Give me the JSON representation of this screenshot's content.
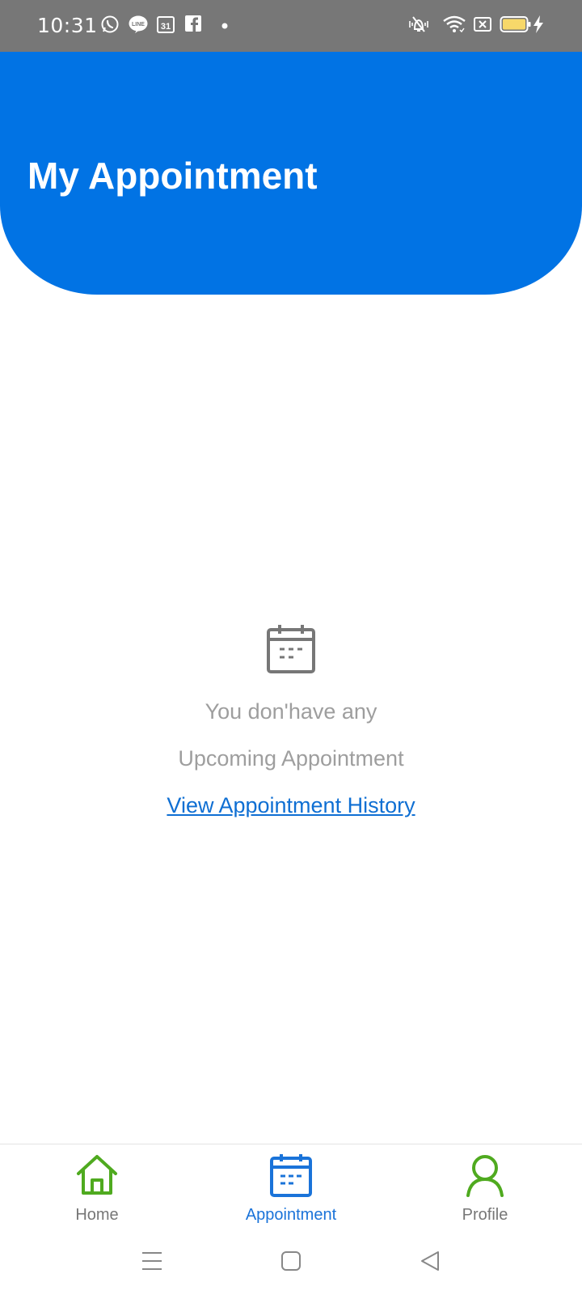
{
  "status_bar": {
    "time": "10:31",
    "left_icons": [
      "whatsapp-icon",
      "line-icon",
      "calendar-31-icon",
      "facebook-icon",
      "dot-icon"
    ],
    "right_icons": [
      "vibrate-off-icon",
      "wifi-icon",
      "no-sim-icon",
      "battery-icon",
      "charging-icon"
    ],
    "calendar_day": "31"
  },
  "header": {
    "title": "My Appointment",
    "color": "#0173e4"
  },
  "empty_state": {
    "icon": "calendar-icon",
    "line1": "You don'have any",
    "line2": "Upcoming Appointment",
    "link_label": "View Appointment History"
  },
  "bottom_nav": {
    "items": [
      {
        "label": "Home",
        "icon": "home-icon",
        "color": "#4faa1f",
        "label_color": "#777777"
      },
      {
        "label": "Appointment",
        "icon": "calendar-icon",
        "color": "#1a73d9",
        "label_color": "#1a73d9",
        "active": true
      },
      {
        "label": "Profile",
        "icon": "person-icon",
        "color": "#4faa1f",
        "label_color": "#777777"
      }
    ]
  },
  "system_nav": {
    "buttons": [
      "menu-icon",
      "home-square-icon",
      "back-triangle-icon"
    ]
  }
}
